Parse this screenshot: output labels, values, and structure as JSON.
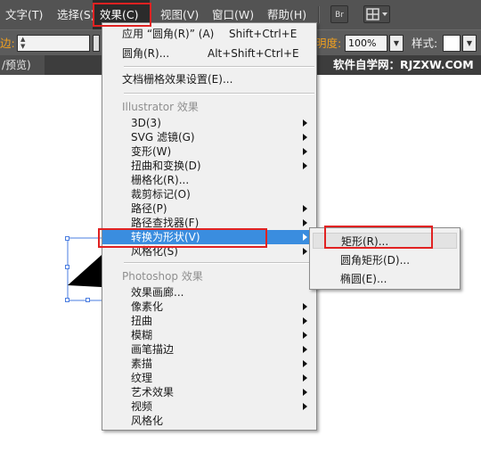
{
  "menubar": {
    "items": [
      "文字(T)",
      "选择(S)",
      "效果(C)",
      "视图(V)",
      "窗口(W)",
      "帮助(H)"
    ],
    "br_icon": "Br",
    "arrange_icon": "arrange-documents-icon"
  },
  "control_bar": {
    "stroke_label": "边:",
    "opacity_label": "明度:",
    "opacity_value": "100%",
    "style_label": "样式:"
  },
  "tab": {
    "doc_label": "/预览)"
  },
  "watermark": "软件自学网：RJZXW.COM",
  "effect_menu": {
    "items": [
      {
        "label": "应用 “圆角(R)” (A)",
        "shortcut": "Shift+Ctrl+E"
      },
      {
        "label": "圆角(R)...",
        "shortcut": "Alt+Shift+Ctrl+E"
      },
      {
        "label": "文档栅格效果设置(E)..."
      }
    ],
    "illustrator_header": "Illustrator 效果",
    "illustrator_items": [
      {
        "label": "3D(3)",
        "submenu": true
      },
      {
        "label": "SVG 滤镜(G)",
        "submenu": true
      },
      {
        "label": "变形(W)",
        "submenu": true
      },
      {
        "label": "扭曲和变换(D)",
        "submenu": true
      },
      {
        "label": "栅格化(R)...",
        "submenu": false
      },
      {
        "label": "裁剪标记(O)",
        "submenu": false
      },
      {
        "label": "路径(P)",
        "submenu": true
      },
      {
        "label": "路径查找器(F)",
        "submenu": true
      },
      {
        "label": "转换为形状(V)",
        "submenu": true,
        "highlighted": true
      },
      {
        "label": "风格化(S)",
        "submenu": true
      }
    ],
    "photoshop_header": "Photoshop 效果",
    "photoshop_items": [
      {
        "label": "效果画廊...",
        "submenu": false
      },
      {
        "label": "像素化",
        "submenu": true
      },
      {
        "label": "扭曲",
        "submenu": true
      },
      {
        "label": "模糊",
        "submenu": true
      },
      {
        "label": "画笔描边",
        "submenu": true
      },
      {
        "label": "素描",
        "submenu": true
      },
      {
        "label": "纹理",
        "submenu": true
      },
      {
        "label": "艺术效果",
        "submenu": true
      },
      {
        "label": "视频",
        "submenu": true
      },
      {
        "label": "风格化",
        "submenu": false
      }
    ]
  },
  "convert_submenu": {
    "items": [
      "矩形(R)...",
      "圆角矩形(D)...",
      "椭圆(E)..."
    ]
  },
  "colors": {
    "highlight": "#3a8ddf",
    "annotation_red": "#e12222",
    "menubar": "#535353",
    "menu_bg": "#f0f0f0"
  }
}
